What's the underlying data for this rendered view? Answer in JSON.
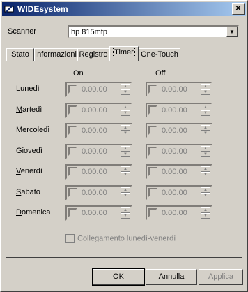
{
  "window": {
    "title": "WIDEsystem"
  },
  "scanner": {
    "label": "Scanner",
    "value": "hp 815mfp"
  },
  "tabs": [
    {
      "label": "Stato"
    },
    {
      "label": "Informazioni"
    },
    {
      "label": "Registro"
    },
    {
      "label": "Timer"
    },
    {
      "label": "One-Touch"
    }
  ],
  "timer": {
    "on_label": "On",
    "off_label": "Off",
    "days": [
      {
        "name": "Lunedì",
        "on": "0.00.00",
        "off": "0.00.00"
      },
      {
        "name": "Martedì",
        "on": "0.00.00",
        "off": "0.00.00"
      },
      {
        "name": "Mercoledì",
        "on": "0.00.00",
        "off": "0.00.00"
      },
      {
        "name": "Giovedì",
        "on": "0.00.00",
        "off": "0.00.00"
      },
      {
        "name": "Venerdì",
        "on": "0.00.00",
        "off": "0.00.00"
      },
      {
        "name": "Sabato",
        "on": "0.00.00",
        "off": "0.00.00"
      },
      {
        "name": "Domenica",
        "on": "0.00.00",
        "off": "0.00.00"
      }
    ],
    "link_label": "Collegamento lunedì-venerdì"
  },
  "buttons": {
    "ok": "OK",
    "cancel": "Annulla",
    "apply": "Applica"
  }
}
